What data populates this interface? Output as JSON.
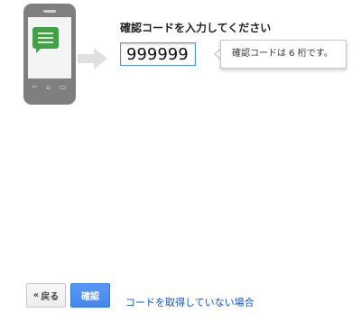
{
  "verification": {
    "prompt": "確認コードを入力してください",
    "code_value": "999999",
    "tooltip": "確認コードは 6 桁です。"
  },
  "actions": {
    "back_label": "戻る",
    "back_glyph": "«",
    "confirm_label": "確認",
    "help_link": "コードを取得していない場合"
  },
  "phone_nav_glyphs": [
    "⌐",
    "⌂",
    "▭"
  ],
  "colors": {
    "phone_body": "#7f7f7f",
    "sms_bubble": "#43a047",
    "primary_button": "#4787ed",
    "link": "#1155cc",
    "input_focus": "#4d90fe"
  }
}
